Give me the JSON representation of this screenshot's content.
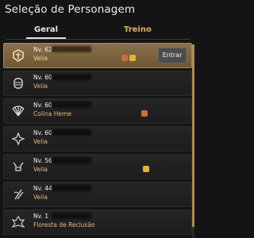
{
  "window": {
    "title": "Seleção de Personagem"
  },
  "tabs": [
    {
      "label": "Geral"
    },
    {
      "label": "Treino"
    }
  ],
  "rows": [
    {
      "level": "Nv. 62",
      "location": "Velia",
      "icon": "warrior-helmet-icon",
      "badges": [
        "boss-icon",
        "gold-icon"
      ],
      "selected": true
    },
    {
      "level": "Nv. 60",
      "location": "Velia",
      "icon": "knight-helm-icon",
      "badges": []
    },
    {
      "level": "Nv. 60",
      "location": "Colina Heme",
      "icon": "fan-icon",
      "badges": [
        "boss-icon"
      ]
    },
    {
      "level": "Nv. 60",
      "location": "Velia",
      "icon": "sorceress-icon",
      "badges": []
    },
    {
      "level": "Nv. 56",
      "location": "Velia",
      "icon": "horned-helm-icon",
      "badges": [
        "gold-icon"
      ]
    },
    {
      "level": "Nv. 44",
      "location": "Velia",
      "icon": "lahn-icon",
      "badges": []
    },
    {
      "level": "Nv. 1",
      "location": "Floresta de Reclusão",
      "icon": "crest-icon",
      "badges": []
    }
  ],
  "buttons": {
    "enter": "Entrar"
  },
  "colors": {
    "accent": "#b08a4f",
    "selected": "#8a7148",
    "location_text": "#e7b77a"
  }
}
